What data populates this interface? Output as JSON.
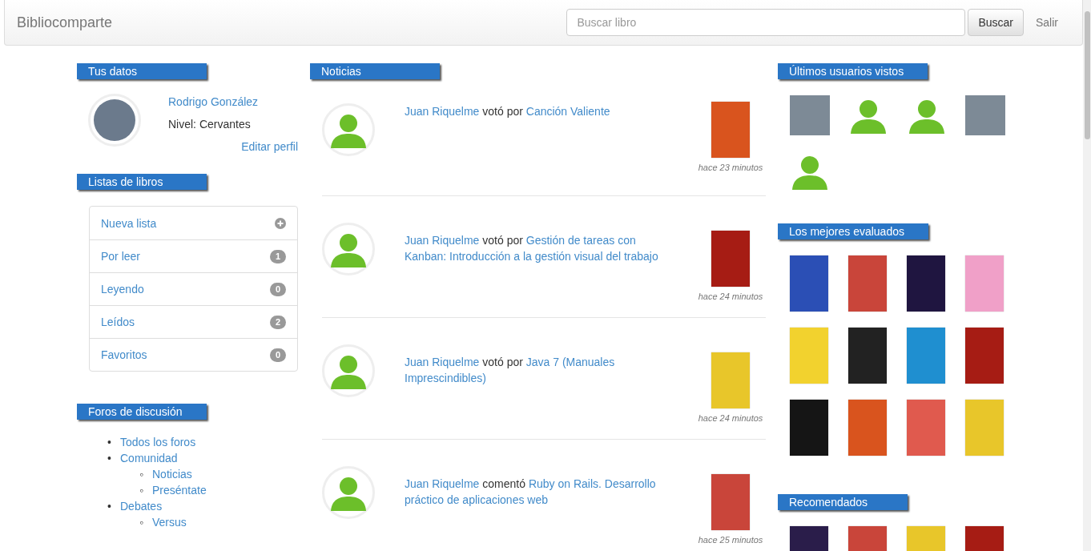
{
  "navbar": {
    "brand": "Bibliocomparte",
    "search": {
      "placeholder": "Buscar libro"
    },
    "search_button": "Buscar",
    "logout": "Salir"
  },
  "profile": {
    "heading": "Tus datos",
    "name": "Rodrigo González",
    "level": "Nivel: Cervantes",
    "edit": "Editar perfil"
  },
  "book_lists": {
    "heading": "Listas de libros",
    "items": [
      {
        "label": "Nueva lista",
        "kind": "add"
      },
      {
        "label": "Por leer",
        "kind": "count",
        "count": "1"
      },
      {
        "label": "Leyendo",
        "kind": "count",
        "count": "0"
      },
      {
        "label": "Leídos",
        "kind": "count",
        "count": "2"
      },
      {
        "label": "Favoritos",
        "kind": "count",
        "count": "0"
      }
    ]
  },
  "forums": {
    "heading": "Foros de discusión",
    "items": [
      {
        "marker": "•",
        "label": "Todos los foros"
      },
      {
        "marker": "•",
        "label": "Comunidad",
        "children": [
          {
            "marker": "◦",
            "label": "Noticias"
          },
          {
            "marker": "◦",
            "label": "Preséntate"
          }
        ]
      },
      {
        "marker": "•",
        "label": "Debates",
        "children": [
          {
            "marker": "◦",
            "label": "Versus"
          }
        ]
      }
    ]
  },
  "news": {
    "heading": "Noticias",
    "items": [
      {
        "user": "Juan Riquelme",
        "action": "votó por",
        "book": "Canción Valiente",
        "cover": {
          "color": "#d9541e"
        },
        "time": "hace 23 minutos"
      },
      {
        "user": "Juan Riquelme",
        "action": "votó por",
        "book": "Gestión de tareas con Kanban: Introducción a la gestión visual del trabajo",
        "cover": {
          "color": "#a61c14"
        },
        "time": "hace 24 minutos"
      },
      {
        "user": "Juan Riquelme",
        "action": "votó por",
        "book": "Java 7 (Manuales Imprescindibles)",
        "cover": {
          "color": "#e8c62a"
        },
        "time": "hace 24 minutos"
      },
      {
        "user": "Juan Riquelme",
        "action": "comentó",
        "book": "Ruby on Rails. Desarrollo práctico de aplicaciones web",
        "cover": {
          "color": "#c9453a"
        },
        "time": "hace 25 minutos"
      }
    ]
  },
  "recent_users": {
    "heading": "Últimos usuarios vistos",
    "users": [
      {
        "kind": "photo"
      },
      {
        "kind": "default"
      },
      {
        "kind": "default"
      },
      {
        "kind": "photo"
      },
      {
        "kind": "default"
      }
    ]
  },
  "top_rated": {
    "heading": "Los mejores evaluados",
    "covers": [
      {
        "color": "#2b4fb5"
      },
      {
        "color": "#c9453a"
      },
      {
        "color": "#1f1540"
      },
      {
        "color": "#f0a0c8"
      },
      {
        "color": "#f2d22e"
      },
      {
        "color": "#222222"
      },
      {
        "color": "#1f8fd0"
      },
      {
        "color": "#a61c14"
      },
      {
        "color": "#151515"
      },
      {
        "color": "#d9541e"
      },
      {
        "color": "#e05a4e"
      },
      {
        "color": "#e8c62a"
      }
    ]
  },
  "recommended": {
    "heading": "Recomendados",
    "covers": [
      {
        "color": "#2a1d4a"
      },
      {
        "color": "#c9453a"
      },
      {
        "color": "#e8c62a"
      },
      {
        "color": "#a61c14"
      }
    ]
  }
}
